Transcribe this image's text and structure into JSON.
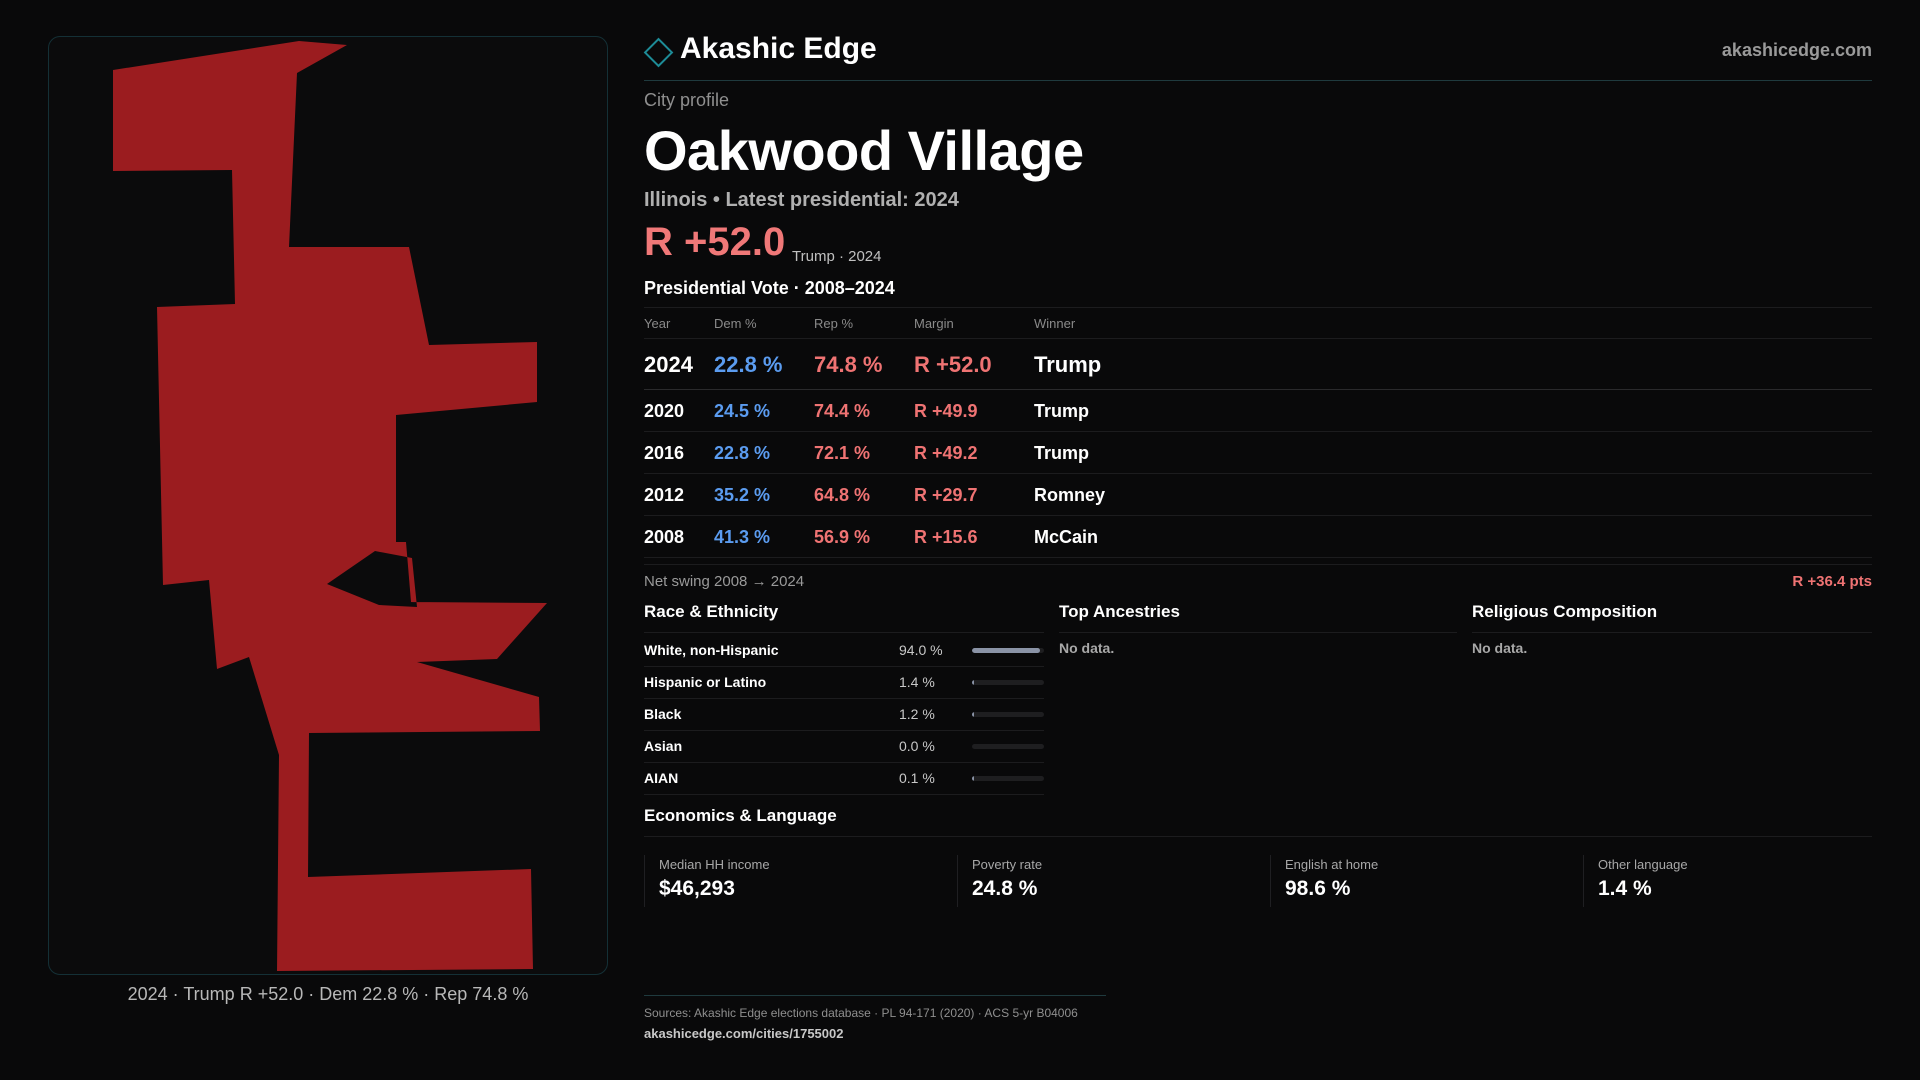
{
  "brand": {
    "name": "Akashic Edge",
    "site": "akashicedge.com",
    "icon": "diamond-logo-icon"
  },
  "profile": {
    "kicker": "City profile",
    "title": "Oakwood Village",
    "subtitle": "Illinois • Latest presidential: 2024",
    "margin_big": "R +52.0",
    "margin_note": "Trump · 2024"
  },
  "map": {
    "caption": "2024 · Trump R +52.0 · Dem 22.8 % · Rep 74.8 %",
    "fill_color": "#9b1c1f"
  },
  "presidential": {
    "heading": "Presidential Vote · 2008–2024",
    "columns": {
      "year": "Year",
      "dem": "Dem %",
      "rep": "Rep %",
      "margin": "Margin",
      "winner": "Winner"
    },
    "rows": [
      {
        "year": "2024",
        "dem": "22.8 %",
        "rep": "74.8 %",
        "margin": "R +52.0",
        "winner": "Trump"
      },
      {
        "year": "2020",
        "dem": "24.5 %",
        "rep": "74.4 %",
        "margin": "R +49.9",
        "winner": "Trump"
      },
      {
        "year": "2016",
        "dem": "22.8 %",
        "rep": "72.1 %",
        "margin": "R +49.2",
        "winner": "Trump"
      },
      {
        "year": "2012",
        "dem": "35.2 %",
        "rep": "64.8 %",
        "margin": "R +29.7",
        "winner": "Romney"
      },
      {
        "year": "2008",
        "dem": "41.3 %",
        "rep": "56.9 %",
        "margin": "R +15.6",
        "winner": "McCain"
      }
    ],
    "swing_label": "Net swing 2008 → 2024",
    "swing_value": "R +36.4 pts"
  },
  "colors": {
    "dem": "#5b9cf0",
    "rep": "#ef7373",
    "accent": "#1d8c97"
  },
  "race": {
    "title": "Race & Ethnicity",
    "rows": [
      {
        "name": "White, non-Hispanic",
        "pct": "94.0 %",
        "share": 0.94
      },
      {
        "name": "Hispanic or Latino",
        "pct": "1.4 %",
        "share": 0.014
      },
      {
        "name": "Black",
        "pct": "1.2 %",
        "share": 0.012
      },
      {
        "name": "Asian",
        "pct": "0.0 %",
        "share": 0.0
      },
      {
        "name": "AIAN",
        "pct": "0.1 %",
        "share": 0.001
      }
    ]
  },
  "ancestries": {
    "title": "Top Ancestries",
    "empty": "No data."
  },
  "religion": {
    "title": "Religious Composition",
    "empty": "No data."
  },
  "economics": {
    "title": "Economics & Language",
    "cards": [
      {
        "label": "Median HH income",
        "value": "$46,293"
      },
      {
        "label": "Poverty rate",
        "value": "24.8 %"
      },
      {
        "label": "English at home",
        "value": "98.6 %"
      },
      {
        "label": "Other language",
        "value": "1.4 %"
      }
    ]
  },
  "footer": {
    "sources": "Sources: Akashic Edge elections database · PL 94-171 (2020) · ACS 5-yr B04006",
    "url": "akashicedge.com/cities/1755002"
  }
}
